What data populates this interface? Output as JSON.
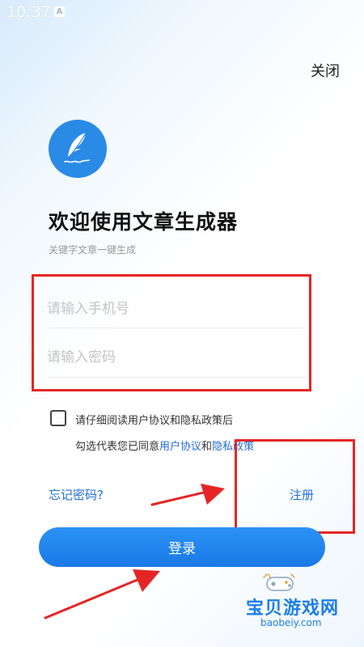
{
  "status_bar": {
    "time": "10:37",
    "notification_letter": "A"
  },
  "header": {
    "close_label": "关闭"
  },
  "app": {
    "title": "欢迎使用文章生成器",
    "subtitle": "关键字文章一键生成",
    "logo_icon": "feather-pen-icon",
    "accent_color": "#1f6fd4"
  },
  "form": {
    "phone_placeholder": "请输入手机号",
    "password_placeholder": "请输入密码"
  },
  "agreement": {
    "checked": false,
    "line1": "请仔细阅读用户协议和隐私政策后",
    "line2_prefix": "勾选代表您已同意",
    "user_agreement_link": "用户协议",
    "conjunction": "和",
    "privacy_policy_link": "隐私政策"
  },
  "links": {
    "forgot_password": "忘记密码?",
    "register": "注册"
  },
  "login_button": {
    "label": "登录"
  },
  "annotation": {
    "highlight_color": "#e52525"
  },
  "watermark": {
    "name": "宝贝游戏网",
    "url": "baobeiy.com"
  }
}
